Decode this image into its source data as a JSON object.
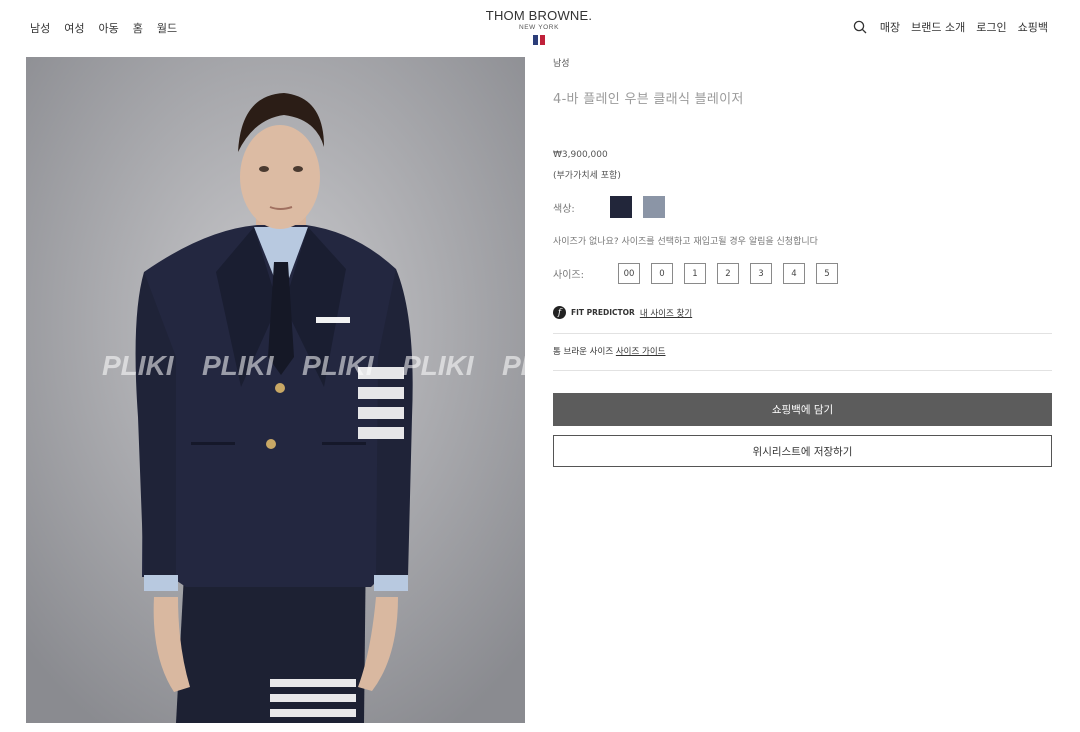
{
  "header": {
    "nav_left": [
      "남성",
      "여성",
      "아동",
      "홈",
      "월드"
    ],
    "logo_main": "THOM BROWNE.",
    "logo_sub": "NEW YORK",
    "nav_right": [
      "매장",
      "브랜드 소개",
      "로그인",
      "쇼핑백"
    ],
    "search_icon": "search-icon",
    "flag_colors": [
      "#2c3e7a",
      "#ffffff",
      "#c0213a"
    ]
  },
  "image": {
    "watermark": "PLIKI",
    "alt": "4-바 플레인 우븐 클래식 블레이저"
  },
  "product": {
    "breadcrumb": "남성",
    "title": "4-바 플레인 우븐 클래식 블레이저",
    "price": "₩3,900,000",
    "vat_note": "(부가가치세 포함)",
    "color_label": "색상:",
    "colors": [
      {
        "name": "navy",
        "hex": "#22263a"
      },
      {
        "name": "grey",
        "hex": "#8b95a6"
      }
    ],
    "size_note": "사이즈가 없나요? 사이즈를 선택하고 재입고될 경우 알림을 신청합니다",
    "size_label": "사이즈:",
    "sizes": [
      "00",
      "0",
      "1",
      "2",
      "3",
      "4",
      "5"
    ],
    "fit_brand": "FIT PREDICTOR",
    "fit_link": "내 사이즈 찾기",
    "guide_text": "톰 브라운 사이즈",
    "guide_link": "사이즈 가이드",
    "add_to_bag": "쇼핑백에 담기",
    "add_to_wishlist": "위시리스트에 저장하기"
  }
}
